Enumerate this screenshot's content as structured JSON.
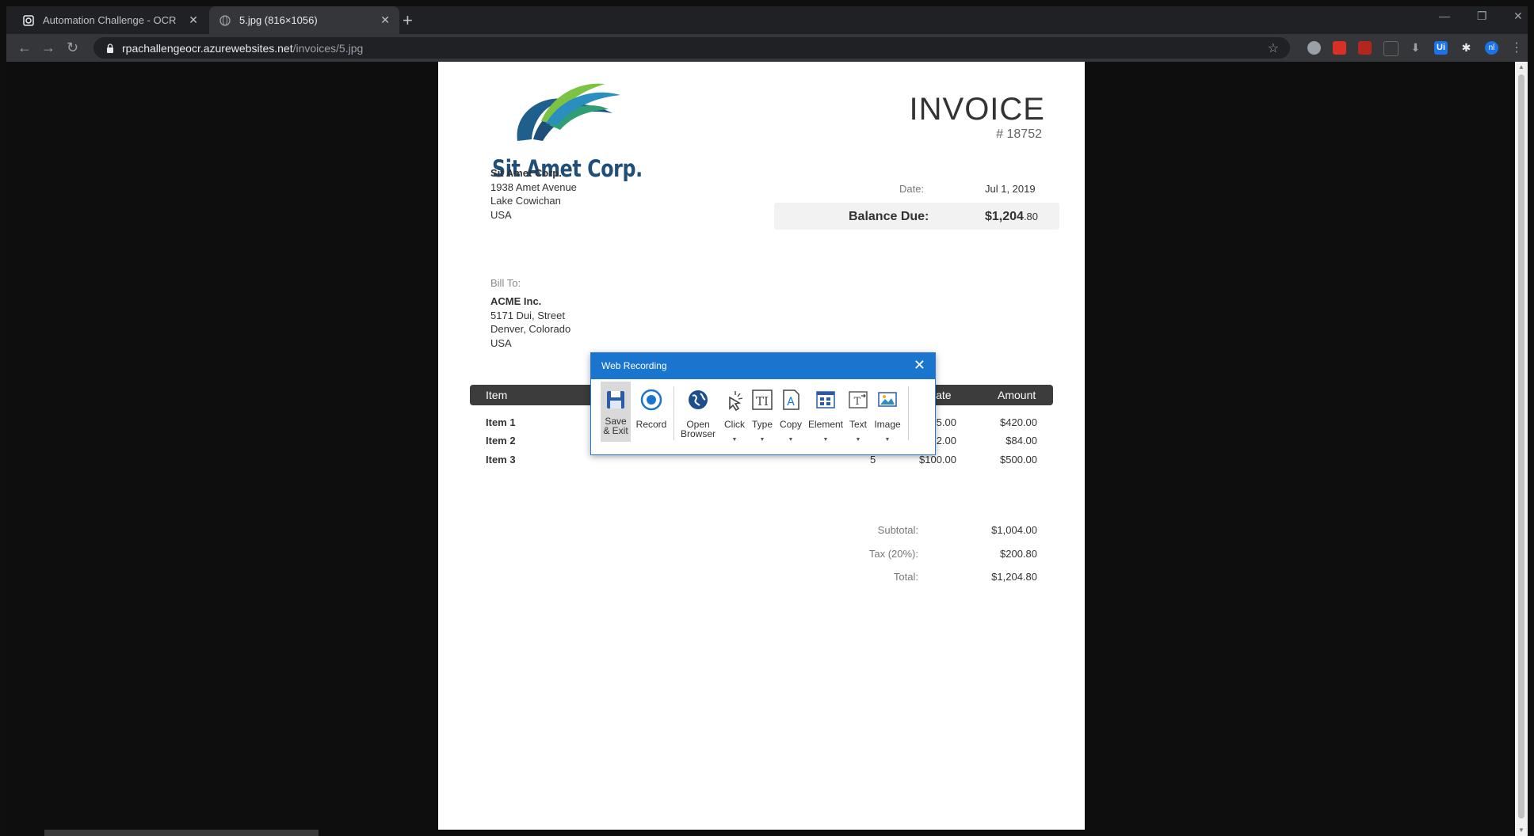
{
  "browser": {
    "tabs": [
      {
        "label": "Automation Challenge - OCR",
        "active": false
      },
      {
        "label": "5.jpg (816×1056)",
        "active": true
      }
    ],
    "address": {
      "host": "rpachallengeocr.azurewebsites.net",
      "path": "/invoices/5.jpg"
    },
    "extensions": [
      "circle-ext-icon",
      "m-ext-icon",
      "pdf-ext-icon",
      "link-ext-icon",
      "download-ext-icon",
      "ui-ext-icon",
      "puzzle-icon",
      "profile-avatar"
    ],
    "profile_initials": "nl",
    "ui_ext_label": "Ui"
  },
  "invoice": {
    "company_logo_text": "Sit Amet Corp.",
    "title": "INVOICE",
    "number": "# 18752",
    "date_label": "Date:",
    "date_value": "Jul 1, 2019",
    "balance_label": "Balance Due:",
    "balance_value_main": "$1,204",
    "balance_value_cents": ".80",
    "from": [
      "Sit Amet Corp.",
      "1938 Amet Avenue",
      "Lake Cowichan",
      "USA"
    ],
    "bill_to_label": "Bill To:",
    "bill_to": [
      "ACME Inc.",
      "5171 Dui, Street",
      "Denver, Colorado",
      "USA"
    ],
    "table_headers": {
      "item": "Item",
      "rate": "Rate",
      "amount": "Amount"
    },
    "rows": [
      {
        "item": "Item 1",
        "qty": "",
        "rate": "35.00",
        "amount": "$420.00"
      },
      {
        "item": "Item 2",
        "qty": "",
        "rate": "2.00",
        "amount": "$84.00"
      },
      {
        "item": "Item 3",
        "qty": "5",
        "rate": "$100.00",
        "amount": "$500.00"
      }
    ],
    "subtotal_label": "Subtotal:",
    "subtotal_value": "$1,004.00",
    "tax_label": "Tax (20%):",
    "tax_value": "$200.80",
    "total_label": "Total:",
    "total_value": "$1,204.80"
  },
  "recorder": {
    "title": "Web Recording",
    "tools": [
      {
        "name": "save-exit",
        "label": "Save\n& Exit",
        "icon": "save-icon"
      },
      {
        "name": "record",
        "label": "Record",
        "icon": "record-icon"
      },
      {
        "name": "open-browser",
        "label": "Open\nBrowser",
        "icon": "globe-icon"
      },
      {
        "name": "click",
        "label": "Click",
        "icon": "click-icon"
      },
      {
        "name": "type",
        "label": "Type",
        "icon": "type-icon"
      },
      {
        "name": "copy",
        "label": "Copy",
        "icon": "copy-icon"
      },
      {
        "name": "element",
        "label": "Element",
        "icon": "element-icon"
      },
      {
        "name": "text",
        "label": "Text",
        "icon": "text-icon"
      },
      {
        "name": "image",
        "label": "Image",
        "icon": "image-icon"
      }
    ]
  },
  "colors": {
    "accent": "#1a75cf",
    "logo_blue": "#1f4e79"
  }
}
